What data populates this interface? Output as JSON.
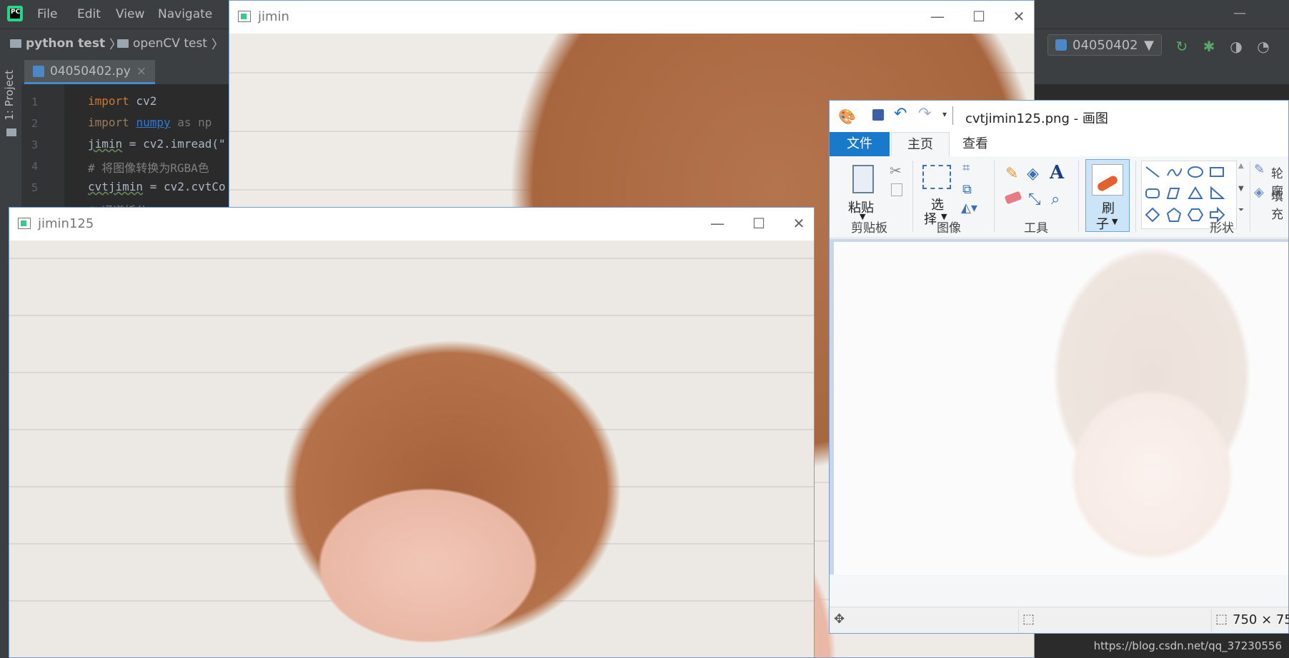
{
  "ide": {
    "menu": [
      "File",
      "Edit",
      "View",
      "Navigate"
    ],
    "breadcrumbs": [
      "python test",
      "openCV test"
    ],
    "file_tab": "04050402.py",
    "project_tab": "1: Project",
    "run_config": "04050402",
    "line_numbers": [
      "1",
      "2",
      "3",
      "4",
      "5"
    ],
    "code": {
      "l1_kw": "import",
      "l1_rest": " cv2",
      "l2_kw": "import",
      "l2_mod": "numpy",
      "l2_rest": " as np",
      "l3_var": "jimin",
      "l3_rest": " = cv2.imread(\"",
      "l4_comment": "# 将图像转换为RGBA色",
      "l5_var": "cvtjimin",
      "l5_rest": " = cv2.cvtCo",
      "l6_comment": "# 通道拆分"
    }
  },
  "window_jimin": {
    "title": "jimin"
  },
  "window_jimin125": {
    "title": "jimin125"
  },
  "paint": {
    "title": "cvtjimin125.png - 画图",
    "tabs": {
      "file": "文件",
      "home": "主页",
      "view": "查看"
    },
    "groups": {
      "clipboard": "剪贴板",
      "image": "图像",
      "tools": "工具",
      "shapes": "形状"
    },
    "paste_label": "粘贴",
    "select_label_1": "选",
    "select_label_2": "择",
    "brush_label_1": "刷",
    "brush_label_2": "子",
    "outline_label": "轮廓",
    "fill_label": "填充",
    "status_size": "750 × 75"
  },
  "watermark": "https://blog.csdn.net/qq_37230556",
  "colors": {
    "ide_bg": "#2b2b2b",
    "ide_chrome": "#3c3f41",
    "paint_file_tab": "#1979ca",
    "brush_selected": "#cce4f7"
  }
}
